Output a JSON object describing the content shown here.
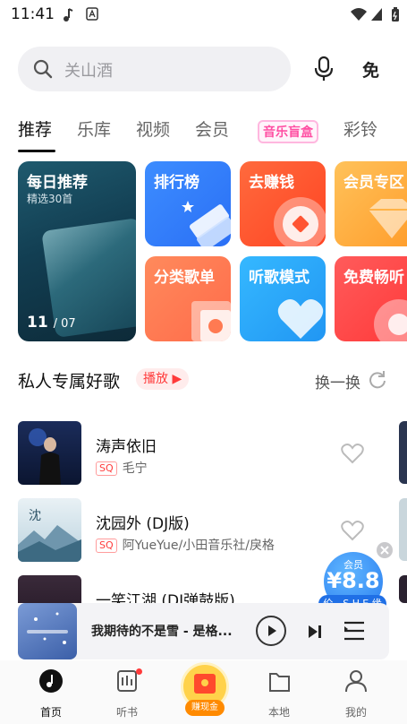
{
  "status_bar": {
    "time": "11:41"
  },
  "search": {
    "placeholder": "关山酒"
  },
  "tabs": [
    {
      "label": "推荐",
      "active": true
    },
    {
      "label": "乐库"
    },
    {
      "label": "视频"
    },
    {
      "label": "会员"
    },
    {
      "label": "音乐盲盒"
    },
    {
      "label": "彩铃"
    }
  ],
  "cards": {
    "daily": {
      "title": "每日推荐",
      "subtitle": "精选30首",
      "day": "11",
      "month": "/ 07"
    },
    "rank": {
      "title": "排行榜"
    },
    "earn": {
      "title": "去赚钱"
    },
    "vip": {
      "title": "会员专区"
    },
    "category": {
      "title": "分类歌单"
    },
    "mode": {
      "title": "听歌模式"
    },
    "free": {
      "title": "免费畅听"
    }
  },
  "section": {
    "title": "私人专属好歌",
    "play_label": "播放",
    "refresh_label": "换一换"
  },
  "songs": [
    {
      "title": "涛声依旧",
      "badge": "SQ",
      "artist": "毛宁"
    },
    {
      "title": "沈园外 (DJ版)",
      "badge": "SQ",
      "artist": "阿YueYue/小田音乐社/戾格"
    },
    {
      "title": "一笑江湖 (DJ弹鼓版)"
    }
  ],
  "vip_float": {
    "label": "会员",
    "price": "¥8.8",
    "ribbon": "伦、S.H.E.缘"
  },
  "player": {
    "title": "我期待的不是雪 - 是格..."
  },
  "bottom_nav": [
    {
      "label": "首页",
      "active": true
    },
    {
      "label": "听书"
    },
    {
      "label": "赚现金"
    },
    {
      "label": "本地"
    },
    {
      "label": "我的"
    }
  ],
  "colors": {
    "accent": "#ff3b3b",
    "blue": "#2a7df0"
  }
}
